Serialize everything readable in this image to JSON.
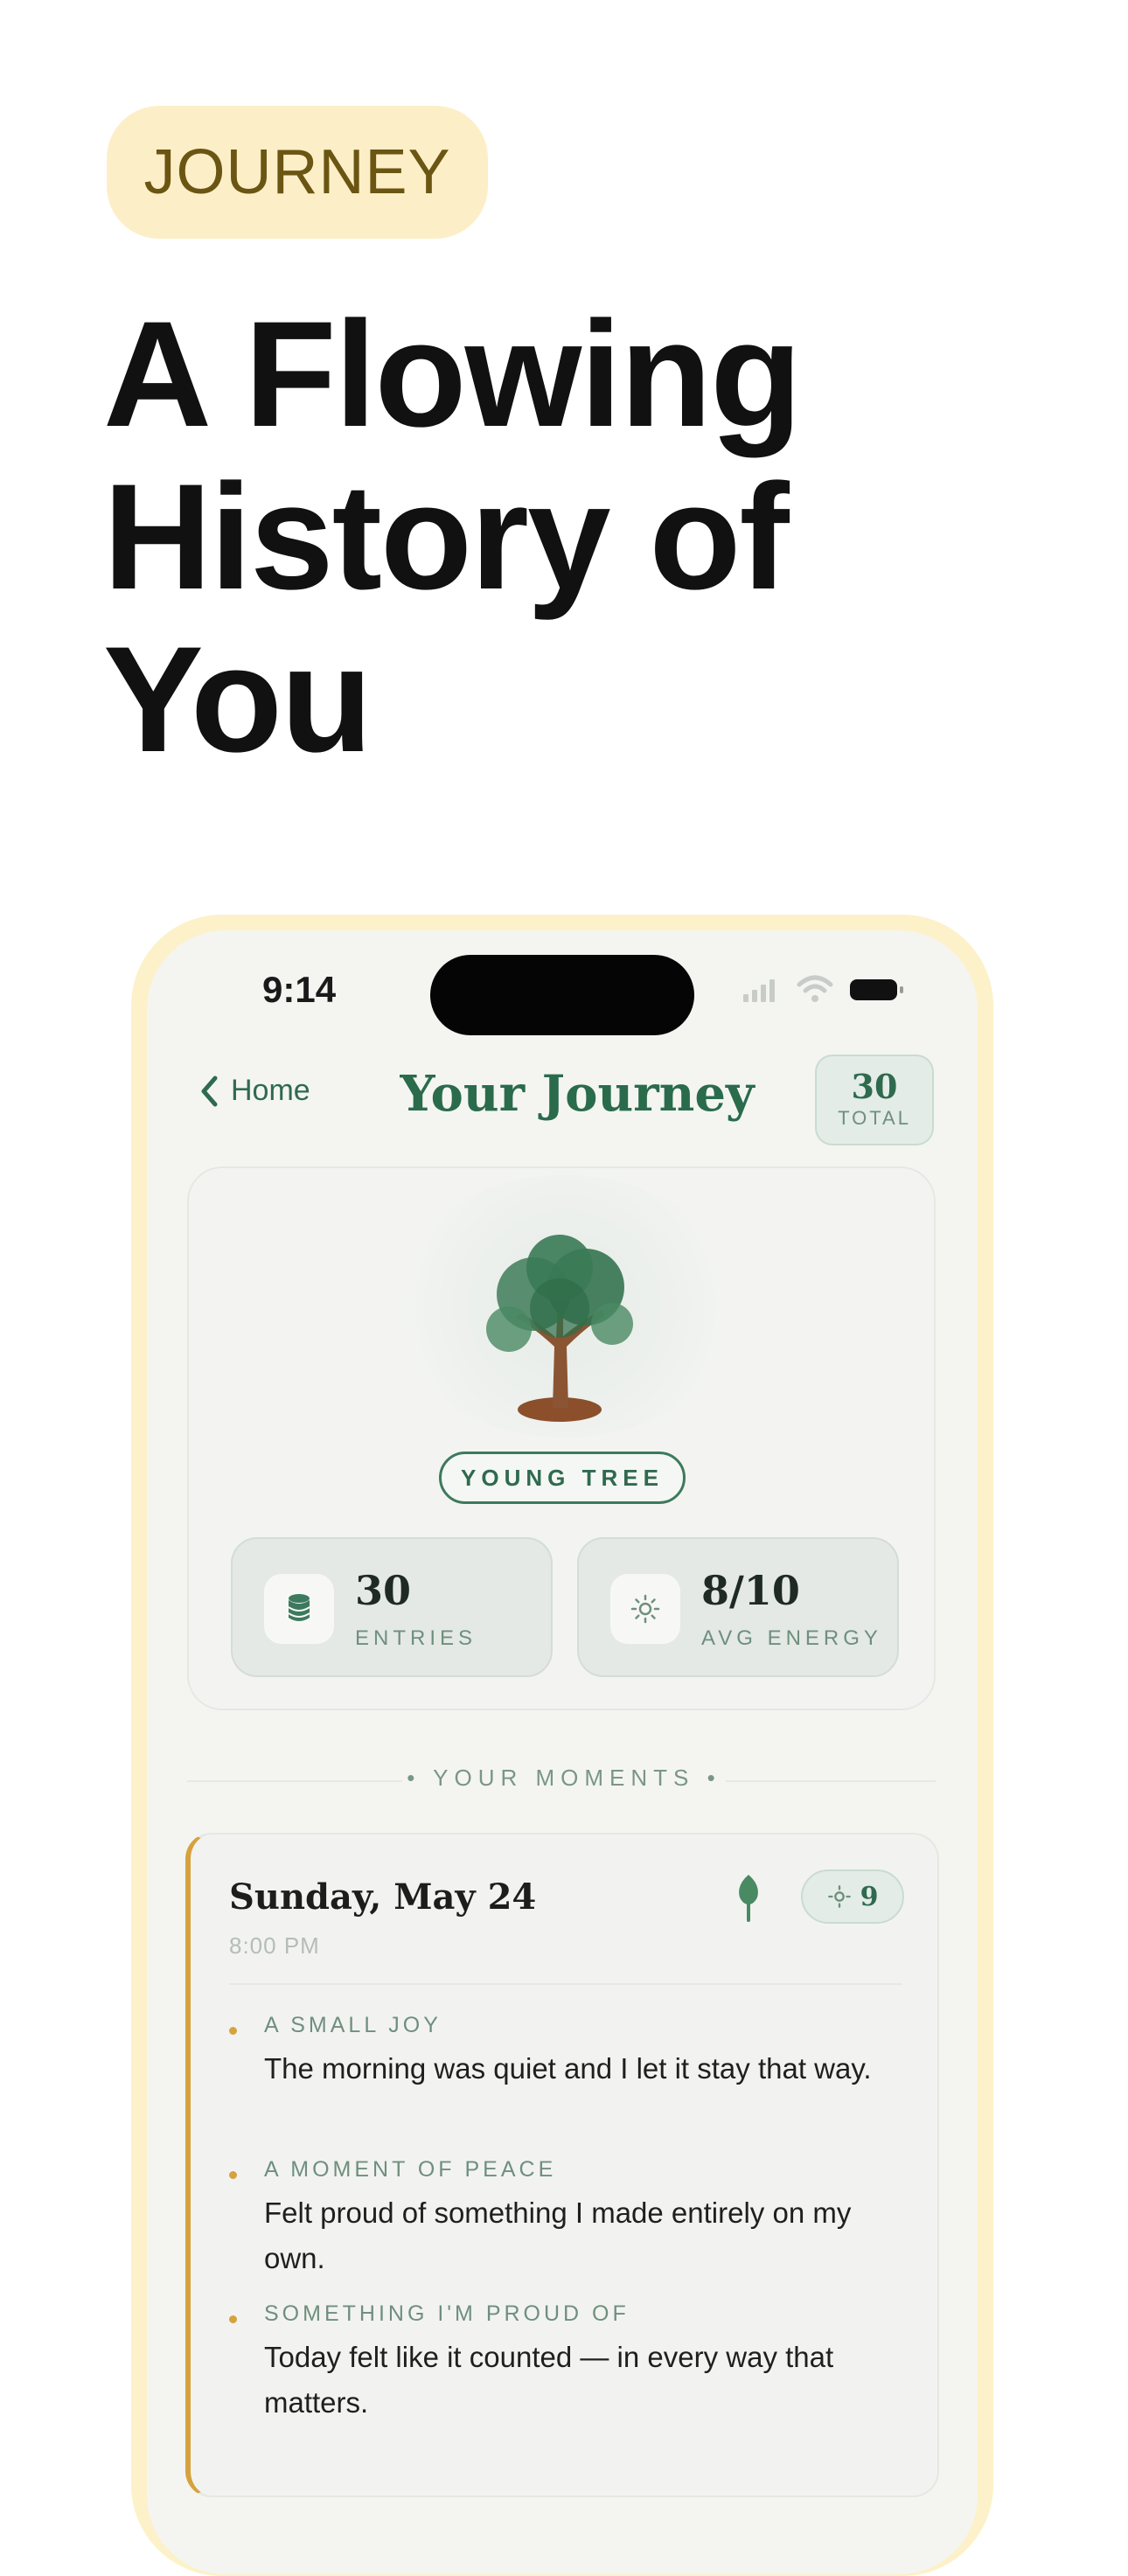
{
  "promo": {
    "badge": "JOURNEY",
    "headline": [
      "A Flowing",
      "History of",
      "You"
    ]
  },
  "status_bar": {
    "time": "9:14"
  },
  "nav": {
    "back_label": "Home",
    "title": "Your Journey",
    "total_count": "30",
    "total_label": "TOTAL"
  },
  "tree_card": {
    "stage": "YOUNG TREE",
    "stats": [
      {
        "icon": "database-icon",
        "value": "30",
        "label": "ENTRIES"
      },
      {
        "icon": "sun-icon",
        "value": "8/10",
        "label": "AVG ENERGY"
      }
    ]
  },
  "moments_header": "• YOUR MOMENTS •",
  "entry": {
    "date": "Sunday, May 24",
    "time": "8:00 PM",
    "energy": "9",
    "items": [
      {
        "category": "A SMALL JOY",
        "text": "The morning was quiet and I let it stay that way."
      },
      {
        "category": "A MOMENT OF PEACE",
        "text": "Felt proud of something I made entirely on my own."
      },
      {
        "category": "SOMETHING I'M PROUD OF",
        "text": "Today felt like it counted — in every way that matters."
      }
    ]
  },
  "colors": {
    "accent_green": "#2a6b4c",
    "badge_bg": "#fcefc8",
    "frame": "#fcf1c9",
    "entry_accent": "#d6a23e"
  }
}
